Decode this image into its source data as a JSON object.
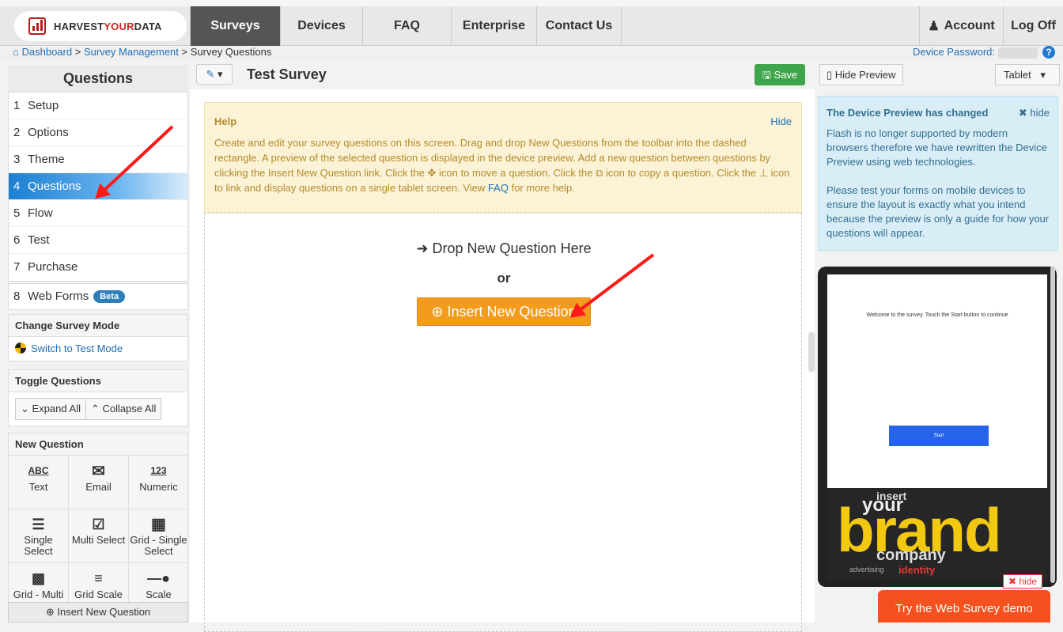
{
  "brand": {
    "name_a": "HARVEST",
    "name_b": "YOUR",
    "name_c": "DATA"
  },
  "nav": {
    "tabs": [
      "Surveys",
      "Devices",
      "FAQ",
      "Enterprise",
      "Contact Us"
    ],
    "account": "Account",
    "logoff": "Log Off"
  },
  "breadcrumb": {
    "dashboard": "Dashboard",
    "survey_mgmt": "Survey Management",
    "current": "Survey Questions",
    "sep": ">"
  },
  "device_password_label": "Device Password:",
  "help_icon": "?",
  "sidebar": {
    "title": "Questions",
    "steps": [
      {
        "n": "1",
        "label": "Setup"
      },
      {
        "n": "2",
        "label": "Options"
      },
      {
        "n": "3",
        "label": "Theme"
      },
      {
        "n": "4",
        "label": "Questions"
      },
      {
        "n": "5",
        "label": "Flow"
      },
      {
        "n": "6",
        "label": "Test"
      },
      {
        "n": "7",
        "label": "Purchase"
      }
    ],
    "webforms": {
      "n": "8",
      "label": "Web Forms",
      "badge": "Beta"
    },
    "change_mode": {
      "header": "Change Survey Mode",
      "link": "Switch to Test Mode"
    },
    "toggle": {
      "header": "Toggle Questions",
      "expand": "Expand All",
      "collapse": "Collapse All"
    },
    "new_question": {
      "header": "New Question",
      "types": [
        "Text",
        "Email",
        "Numeric",
        "Single Select",
        "Multi Select",
        "Grid - Single Select",
        "Grid - Multi",
        "Grid Scale",
        "Scale"
      ]
    },
    "insert_button": "Insert New Question"
  },
  "toolbar": {
    "survey_title": "Test Survey",
    "save": "Save",
    "edit_icon": "pencil-icon"
  },
  "help": {
    "title": "Help",
    "hide": "Hide",
    "text_1": "Create and edit your survey questions on this screen. Drag and drop New Questions from the toolbar into the dashed rectangle. A preview of the selected question is displayed in the device preview. Add a new question between questions by clicking the Insert New Question link. Click the",
    "text_2": "icon to move a question. Click the",
    "text_3": "icon to copy a question. Click the",
    "text_4": "icon to link and display questions on a single tablet screen. View",
    "faq_link": "FAQ",
    "text_5": "for more help."
  },
  "dropzone": {
    "drop_text": "Drop New Question Here",
    "or": "or",
    "insert": "Insert New Question"
  },
  "preview": {
    "hide_preview": "Hide Preview",
    "device_select": "Tablet",
    "notice_title": "The Device Preview has changed",
    "notice_hide": "hide",
    "notice_p1": "Flash is no longer supported by modern browsers therefore we have rewritten the Device Preview using web technologies.",
    "notice_p2": "Please test your forms on mobile devices to ensure the layout is exactly what you intend because the preview is only a guide for how your questions will appear.",
    "welcome": "Welcome to the survey. Touch the Start button to continue",
    "start": "Start",
    "brand_words": {
      "insert": "insert",
      "your": "your",
      "brand": "brand",
      "company": "company",
      "identity": "identity",
      "advertising": "advertising"
    },
    "hide_badge": "hide",
    "try_demo": "Try the Web Survey demo"
  },
  "colors": {
    "accent_blue": "#1f6fb5",
    "save_green": "#3fa54b",
    "insert_orange": "#f29b1d",
    "demo_orange": "#f4511e",
    "annotation_red": "#ff1a1a"
  }
}
